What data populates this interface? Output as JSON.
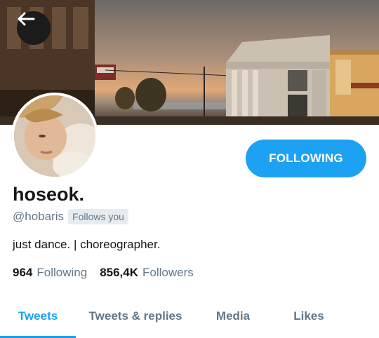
{
  "profile": {
    "display_name": "hoseok.",
    "handle": "@hobaris",
    "follows_you": "Follows you",
    "bio": "just dance. | choreographer."
  },
  "actions": {
    "follow_label": "FOLLOWING"
  },
  "stats": {
    "following_count": "964",
    "following_label": "Following",
    "followers_count": "856,4K",
    "followers_label": "Followers"
  },
  "tabs": [
    {
      "label": "Tweets",
      "active": true
    },
    {
      "label": "Tweets & replies",
      "active": false
    },
    {
      "label": "Media",
      "active": false
    },
    {
      "label": "Likes",
      "active": false
    }
  ],
  "icons": {
    "back": "arrow-left-icon"
  },
  "colors": {
    "accent": "#1da1f2",
    "text_primary": "#14171a",
    "text_secondary": "#657786",
    "badge_bg": "#e6ecf0"
  }
}
